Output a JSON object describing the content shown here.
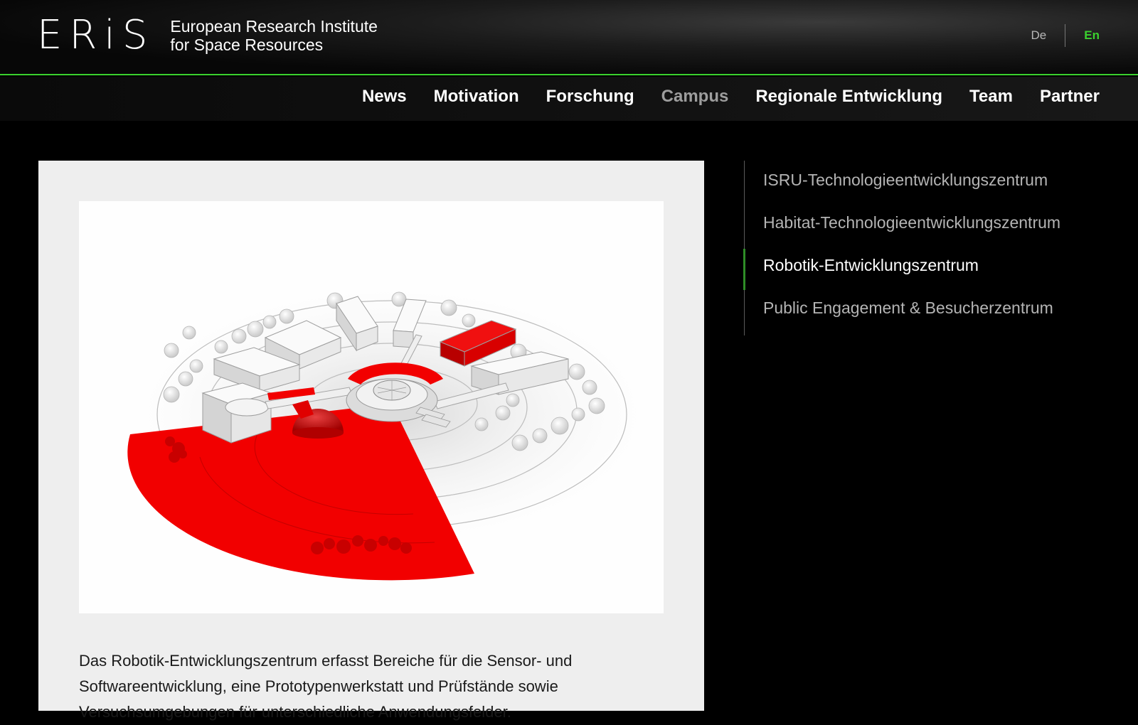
{
  "header": {
    "logo_mark": "ERiS",
    "logo_line1": "European Research Institute",
    "logo_line2": "for Space Resources",
    "lang_de": "De",
    "lang_en": "En",
    "accent_color": "#3ad12e"
  },
  "nav": {
    "items": [
      {
        "label": "News"
      },
      {
        "label": "Motivation"
      },
      {
        "label": "Forschung"
      },
      {
        "label": "Campus"
      },
      {
        "label": "Regionale Entwicklung"
      },
      {
        "label": "Team"
      },
      {
        "label": "Partner"
      }
    ],
    "active": "Campus"
  },
  "main": {
    "image_name": "campus-model-image",
    "caption": "Das Robotik-Entwicklungszentrum erfasst Bereiche für die Sensor- und Softwareentwicklung, eine Prototypenwerkstatt und Prüfstände sowie Versuchsumgebungen für unterschiedliche Anwendungsfelder."
  },
  "subnav": {
    "items": [
      {
        "label": "ISRU-Technologieentwicklungszentrum"
      },
      {
        "label": "Habitat-Technologieentwicklungszentrum"
      },
      {
        "label": "Robotik-Entwicklungszentrum"
      },
      {
        "label": "Public Engagement & Besucherzentrum"
      }
    ],
    "active": "Robotik-Entwicklungszentrum"
  }
}
